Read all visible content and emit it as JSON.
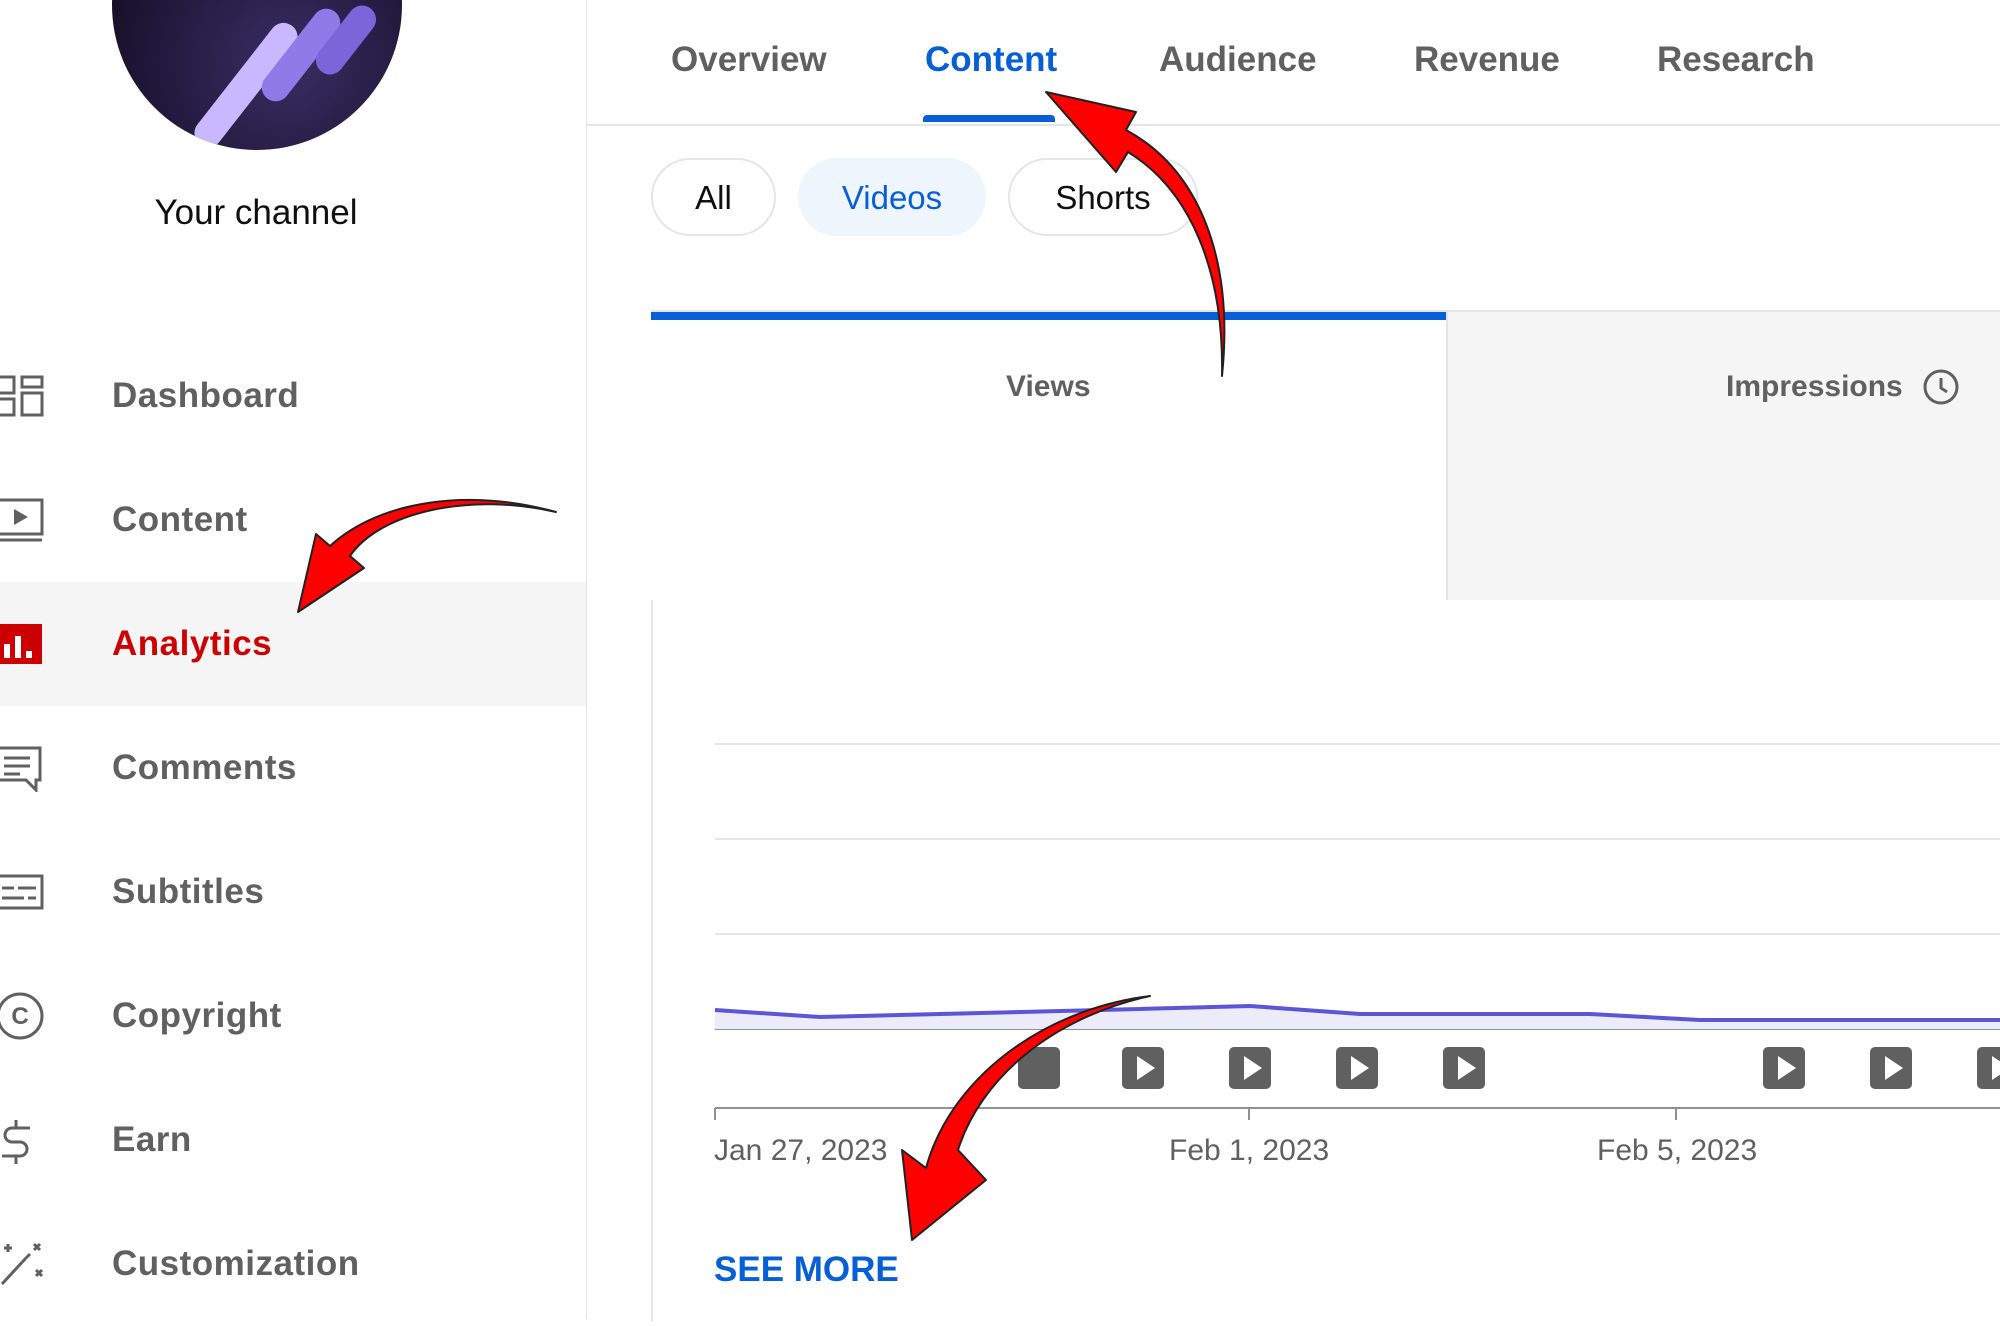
{
  "sidebar": {
    "channel_label": "Your channel",
    "items": [
      {
        "label": "Dashboard",
        "icon": "dashboard-icon"
      },
      {
        "label": "Content",
        "icon": "content-icon"
      },
      {
        "label": "Analytics",
        "icon": "analytics-icon",
        "active": true
      },
      {
        "label": "Comments",
        "icon": "comments-icon"
      },
      {
        "label": "Subtitles",
        "icon": "subtitles-icon"
      },
      {
        "label": "Copyright",
        "icon": "copyright-icon"
      },
      {
        "label": "Earn",
        "icon": "earn-icon"
      },
      {
        "label": "Customization",
        "icon": "customization-icon"
      }
    ]
  },
  "top_tabs": [
    {
      "label": "Overview"
    },
    {
      "label": "Content",
      "active": true
    },
    {
      "label": "Audience"
    },
    {
      "label": "Revenue"
    },
    {
      "label": "Research"
    }
  ],
  "chips": [
    {
      "label": "All"
    },
    {
      "label": "Videos",
      "selected": true
    },
    {
      "label": "Shorts"
    }
  ],
  "metrics": {
    "views_label": "Views",
    "impressions_label": "Impressions",
    "impressions_icon": "clock-icon"
  },
  "chart": {
    "x_labels": [
      "Jan 27, 2023",
      "Feb 1, 2023",
      "Feb 5, 2023"
    ],
    "line_color": "#5c56d6"
  },
  "see_more": "SEE MORE",
  "colors": {
    "accent_blue": "#065fd4",
    "analytics_red": "#cc0000",
    "annotation_red": "#ff0000"
  }
}
